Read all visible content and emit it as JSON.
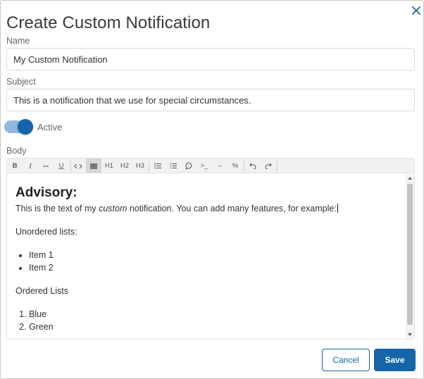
{
  "dialog": {
    "title": "Create Custom Notification",
    "close_icon": "close-icon"
  },
  "form": {
    "name_label": "Name",
    "name_value": "My Custom Notification",
    "subject_label": "Subject",
    "subject_value": "This is a notification that we use for special circumstances.",
    "active_label": "Active",
    "active_on": true,
    "body_label": "Body"
  },
  "toolbar": {
    "bold": "B",
    "italic": "I",
    "strike": "S",
    "underline": "U",
    "code": "<>",
    "block_icon": "block-icon",
    "h1": "H1",
    "h2": "H2",
    "h3": "H3",
    "bullet_list_icon": "bullet-list-icon",
    "ordered_list_icon": "ordered-list-icon",
    "comment_icon": "comment-icon",
    "terminal": ">_",
    "rule": "–",
    "percent": "%",
    "undo_icon": "undo-icon",
    "redo_icon": "redo-icon"
  },
  "body": {
    "heading": "Advisory:",
    "intro_before": "This is the text of my ",
    "intro_em": "custom",
    "intro_after": " notification. You can add many features, for example:",
    "unordered_title": "Unordered lists:",
    "unordered_items": [
      "Item 1",
      "Item 2"
    ],
    "ordered_title": "Ordered Lists",
    "ordered_items": [
      "Blue",
      "Green"
    ]
  },
  "actions": {
    "cancel_label": "Cancel",
    "save_label": "Save"
  },
  "colors": {
    "accent": "#1565a8",
    "toggle_track": "#8fb8dc"
  }
}
